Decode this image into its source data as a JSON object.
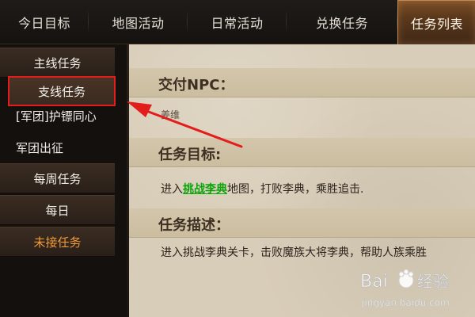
{
  "tabs": [
    {
      "label": "今日目标"
    },
    {
      "label": "地图活动"
    },
    {
      "label": "日常活动"
    },
    {
      "label": "兑换任务"
    },
    {
      "label": "任务列表"
    }
  ],
  "left_menu": [
    {
      "label": "主线任务"
    },
    {
      "label": "支线任务"
    },
    {
      "label": "[军团]护镖同心"
    },
    {
      "label": "军团出征"
    },
    {
      "label": "每周任务"
    },
    {
      "label": "每日"
    },
    {
      "label": "未接任务"
    }
  ],
  "content": {
    "npc_title": "交付NPC：",
    "npc_value": "姜维",
    "goal_title": "任务目标:",
    "goal_prefix": "进入",
    "goal_link": "挑战李典",
    "goal_suffix": "地图，打败李典，乘胜追击.",
    "desc_title": "任务描述：",
    "desc_text": "进入挑战李典关卡，击败魔族大将李典，帮助人族乘胜"
  },
  "watermark": {
    "brand_prefix": "Bai",
    "brand_suffix": "经验",
    "domain": "jingyan.baidu.com"
  },
  "colors": {
    "active_tab": "#6b4422",
    "selection_outline": "#e31c1c",
    "highlight_text": "#0aa50a",
    "orange_text": "#f19a37"
  }
}
